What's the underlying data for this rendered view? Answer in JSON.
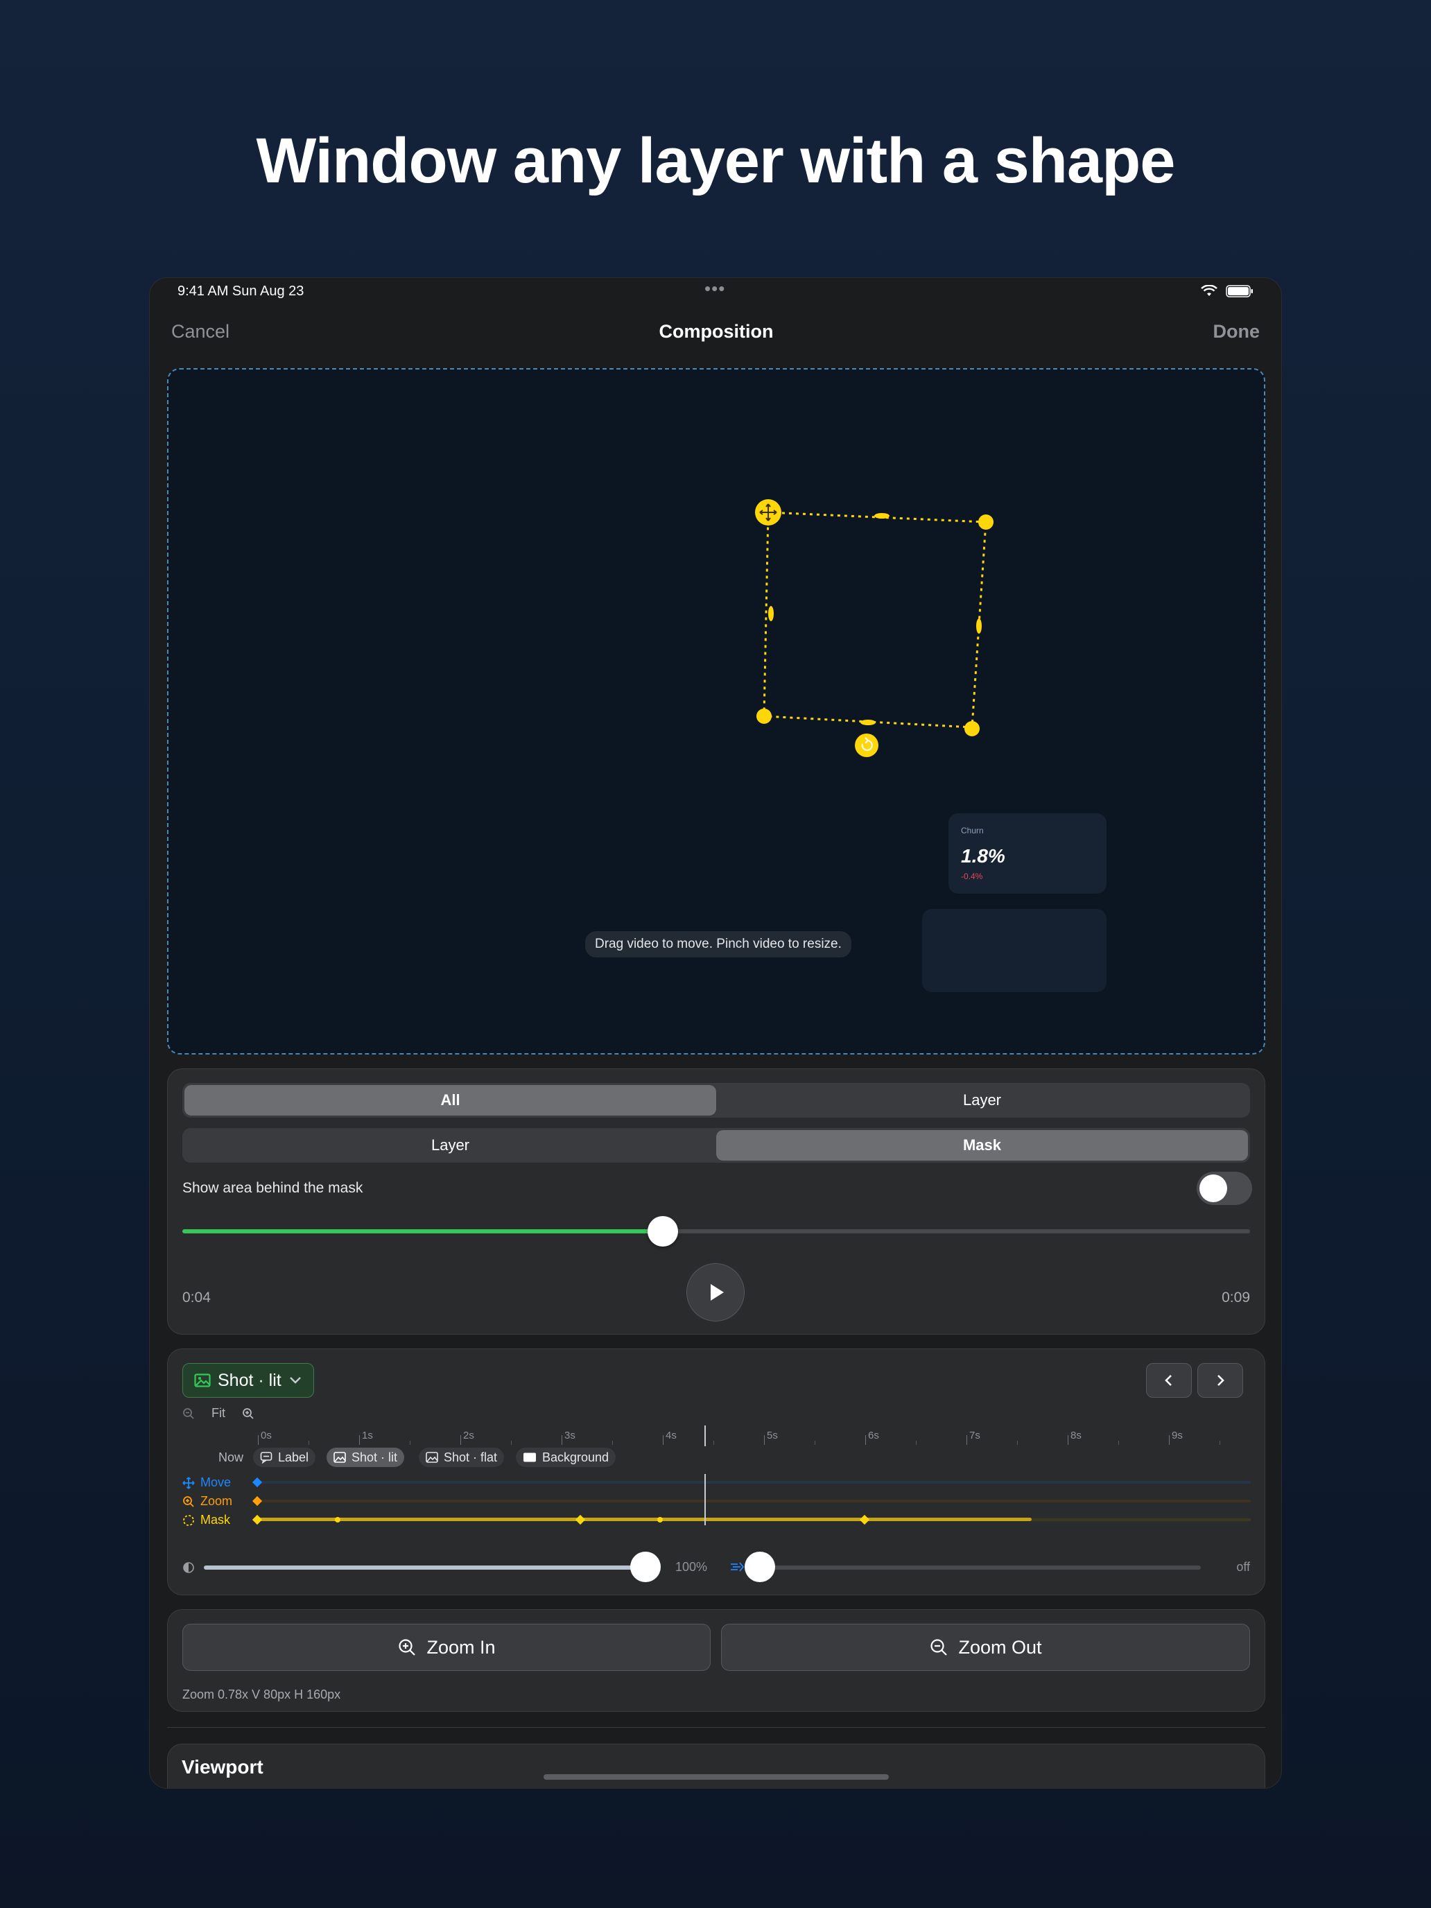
{
  "headline": "Window any layer with a shape",
  "status": {
    "time": "9:41 AM   Sun Aug 23",
    "dots": "•••"
  },
  "nav": {
    "cancel": "Cancel",
    "title": "Composition",
    "done": "Done"
  },
  "canvas": {
    "hint": "Drag video to move. Pinch video to resize.",
    "card": {
      "label": "Churn",
      "value": "1.8%",
      "delta": "-0.4%"
    }
  },
  "controls": {
    "scope_tabs": [
      "All",
      "Layer"
    ],
    "scope_selected": "All",
    "target_tabs": [
      "Layer",
      "Mask"
    ],
    "target_selected": "Mask",
    "toggle_label": "Show area behind the mask",
    "toggle_on": false,
    "time_start": "0:04",
    "time_end": "0:09",
    "progress": 0.45
  },
  "timeline": {
    "layer_selected": "Shot · lit",
    "fit_label": "Fit",
    "ruler": [
      "0s",
      "1s",
      "2s",
      "3s",
      "4s",
      "5s",
      "6s",
      "7s",
      "8s",
      "9s"
    ],
    "now_label": "Now",
    "chips": [
      "Label",
      "Shot · lit",
      "Shot · flat",
      "Background"
    ],
    "tracks": [
      {
        "name": "Move",
        "color": "#1e87ff"
      },
      {
        "name": "Zoom",
        "color": "#ff9f0a"
      },
      {
        "name": "Mask",
        "color": "#ffd60a"
      }
    ],
    "opacity_value": "100%",
    "blur_value": "off"
  },
  "zoom": {
    "zoom_in": "Zoom In",
    "zoom_out": "Zoom Out",
    "info": "Zoom 0.78x  V 80px  H 160px"
  },
  "viewport_title": "Viewport",
  "colors": {
    "accent_yellow": "#ffd60a",
    "accent_green": "#34c759",
    "accent_blue": "#1e87ff"
  }
}
